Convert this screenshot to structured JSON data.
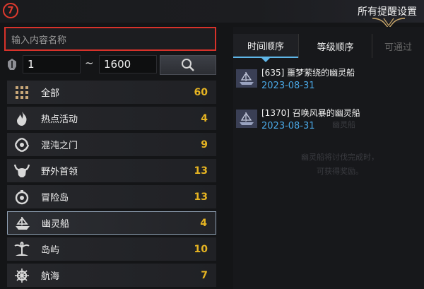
{
  "header": {
    "step_badge": "7",
    "title": "所有提醒设置"
  },
  "search": {
    "placeholder": "输入内容名称",
    "level_min": "1",
    "level_sep": "~",
    "level_max": "1600"
  },
  "categories": [
    {
      "label": "全部",
      "count": "60",
      "icon": "grid-icon"
    },
    {
      "label": "热点活动",
      "count": "4",
      "icon": "fire-icon"
    },
    {
      "label": "混沌之门",
      "count": "9",
      "icon": "vortex-icon"
    },
    {
      "label": "野外首领",
      "count": "13",
      "icon": "horned-skull-icon"
    },
    {
      "label": "冒险岛",
      "count": "13",
      "icon": "compass-icon"
    },
    {
      "label": "幽灵船",
      "count": "4",
      "icon": "ship-icon"
    },
    {
      "label": "岛屿",
      "count": "10",
      "icon": "palm-island-icon"
    },
    {
      "label": "航海",
      "count": "7",
      "icon": "helm-icon"
    }
  ],
  "selected_category": "幽灵船",
  "tabs": [
    {
      "label": "时间顺序",
      "active": true
    },
    {
      "label": "等级顺序",
      "active": false
    },
    {
      "label": "可通过",
      "active": false
    }
  ],
  "entries": [
    {
      "name": "[635] 噩梦萦绕的幽灵船",
      "date": "2023-08-31",
      "icon": "ghost-ship-icon"
    },
    {
      "name": "[1370] 召唤风暴的幽灵船",
      "date": "2023-08-31",
      "icon": "ghost-ship-icon"
    }
  ],
  "background_text": {
    "line1": "幽灵船",
    "line2": "幽灵船将讨伐完成时，",
    "line3": "可获得奖励。"
  },
  "colors": {
    "accent_count": "#e6b422",
    "date_blue": "#4aa8e6",
    "highlight_red": "#d8322a"
  }
}
